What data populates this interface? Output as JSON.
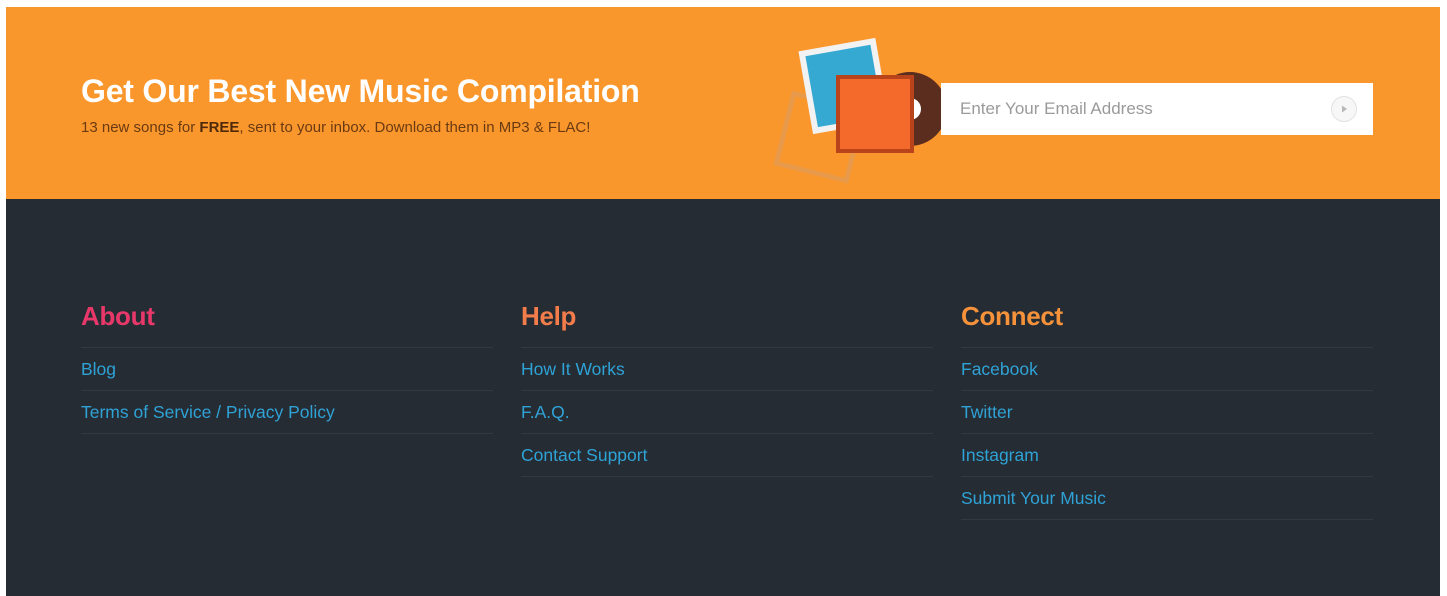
{
  "banner": {
    "title": "Get Our Best New Music Compilation",
    "subtitle_before": "13 new songs for ",
    "subtitle_bold": "FREE",
    "subtitle_after": ", sent to your inbox. Download them in MP3 & FLAC!",
    "email_placeholder": "Enter Your Email Address",
    "colors": {
      "background": "#fa972c",
      "title": "#ffffff"
    }
  },
  "footer": {
    "background": "#252c34",
    "columns": [
      {
        "title": "About",
        "color": "#e8386a",
        "links": [
          "Blog",
          "Terms of Service / Privacy Policy"
        ]
      },
      {
        "title": "Help",
        "color": "#f27c4a",
        "links": [
          "How It Works",
          "F.A.Q.",
          "Contact Support"
        ]
      },
      {
        "title": "Connect",
        "color": "#f5923a",
        "links": [
          "Facebook",
          "Twitter",
          "Instagram",
          "Submit Your Music"
        ]
      }
    ],
    "link_color": "#2fa2d6"
  },
  "icons": {
    "album_art": "album-stack-with-vinyl-icon",
    "submit": "play-arrow-icon"
  }
}
